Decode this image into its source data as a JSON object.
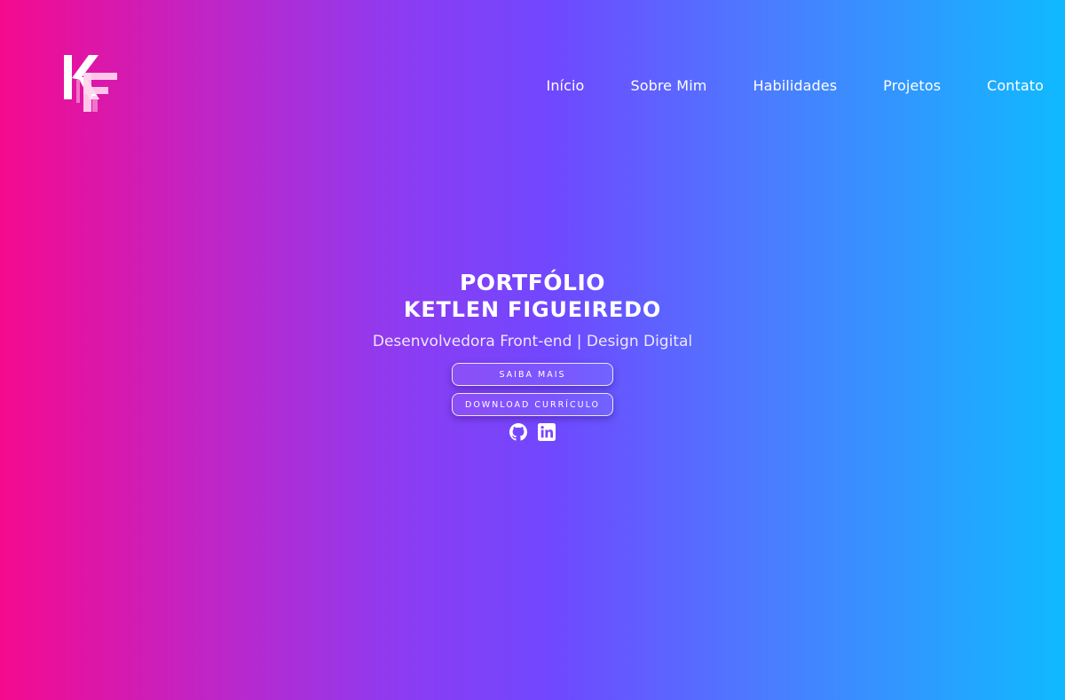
{
  "logo": {
    "text": "KF",
    "icon": "kf-monogram-logo"
  },
  "nav": {
    "items": [
      {
        "label": "Início"
      },
      {
        "label": "Sobre Mim"
      },
      {
        "label": "Habilidades"
      },
      {
        "label": "Projetos"
      },
      {
        "label": "Contato"
      }
    ]
  },
  "hero": {
    "title": "PORTFÓLIO",
    "name": "KETLEN FIGUEIREDO",
    "subtitle": "Desenvolvedora Front-end | Design Digital",
    "buttons": {
      "learn_more": "SAIBA MAIS",
      "download_cv": "DOWNLOAD CURRÍCULO"
    },
    "socials": [
      {
        "icon": "github-icon"
      },
      {
        "icon": "linkedin-icon"
      }
    ]
  },
  "colors": {
    "gradient_start": "#f50a8e",
    "gradient_mid": "#7048ff",
    "gradient_end": "#0fbaff",
    "text": "#ffffff"
  }
}
